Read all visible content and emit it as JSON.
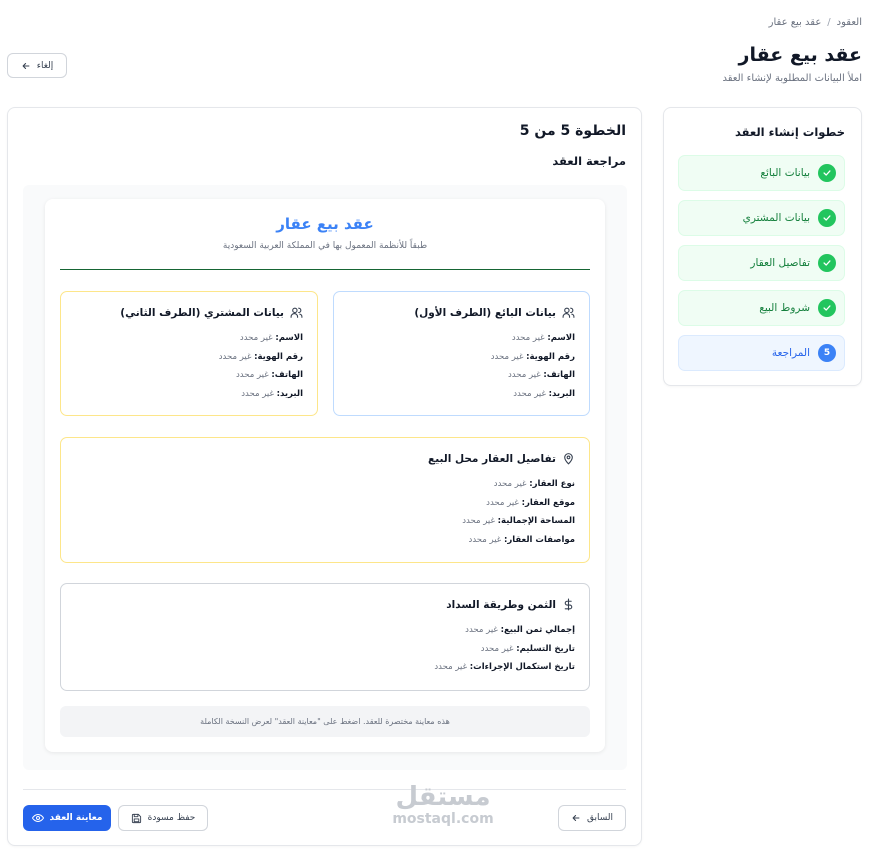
{
  "breadcrumb": {
    "root": "العقود",
    "separator": "/",
    "current": "عقد بيع عقار"
  },
  "header": {
    "title": "عقد بيع عقار",
    "subtitle": "املأ البيانات المطلوبة لإنشاء العقد",
    "cancel_label": "إلغاء"
  },
  "steps": {
    "title": "خطوات إنشاء العقد",
    "items": [
      {
        "label": "بيانات البائع",
        "state": "done"
      },
      {
        "label": "بيانات المشتري",
        "state": "done"
      },
      {
        "label": "تفاصيل العقار",
        "state": "done"
      },
      {
        "label": "شروط البيع",
        "state": "done"
      },
      {
        "label": "المراجعة",
        "state": "current",
        "number": "5"
      }
    ]
  },
  "main": {
    "step_heading": "الخطوة 5 من 5",
    "section_heading": "مراجعة العقد",
    "document": {
      "title": "عقد بيع عقار",
      "subtitle": "طبقاً للأنظمة المعمول بها في المملكة العربية السعودية",
      "seller": {
        "heading": "بيانات البائع (الطرف الأول)",
        "fields": [
          {
            "label": "الاسم:",
            "value": "غير محدد"
          },
          {
            "label": "رقم الهوية:",
            "value": "غير محدد"
          },
          {
            "label": "الهاتف:",
            "value": "غير محدد"
          },
          {
            "label": "البريد:",
            "value": "غير محدد"
          }
        ]
      },
      "buyer": {
        "heading": "بيانات المشتري (الطرف الثاني)",
        "fields": [
          {
            "label": "الاسم:",
            "value": "غير محدد"
          },
          {
            "label": "رقم الهوية:",
            "value": "غير محدد"
          },
          {
            "label": "الهاتف:",
            "value": "غير محدد"
          },
          {
            "label": "البريد:",
            "value": "غير محدد"
          }
        ]
      },
      "property": {
        "heading": "تفاصيل العقار محل البيع",
        "fields": [
          {
            "label": "نوع العقار:",
            "value": "غير محدد"
          },
          {
            "label": "موقع العقار:",
            "value": "غير محدد"
          },
          {
            "label": "المساحة الإجمالية:",
            "value": "غير محدد"
          },
          {
            "label": "مواصفات العقار:",
            "value": "غير محدد"
          }
        ]
      },
      "price": {
        "heading": "الثمن وطريقة السداد",
        "fields": [
          {
            "label": "إجمالي ثمن البيع:",
            "value": "غير محدد"
          },
          {
            "label": "تاريخ التسليم:",
            "value": "غير محدد"
          },
          {
            "label": "تاريخ استكمال الإجراءات:",
            "value": "غير محدد"
          }
        ]
      },
      "note": "هذه معاينة مختصرة للعقد. اضغط على \"معاينة العقد\" لعرض النسخة الكاملة"
    }
  },
  "footer": {
    "preview_label": "معاينة العقد",
    "draft_label": "حفظ مسودة",
    "previous_label": "السابق"
  },
  "watermark": {
    "arabic": "مستقل",
    "latin": "mostaql.com"
  },
  "colors": {
    "accent": "#2563eb",
    "success": "#22c55e",
    "success_bg": "#f0fdf4",
    "current_bg": "#eff6ff",
    "title_blue": "#3b82f6",
    "rule_green": "#166534"
  }
}
